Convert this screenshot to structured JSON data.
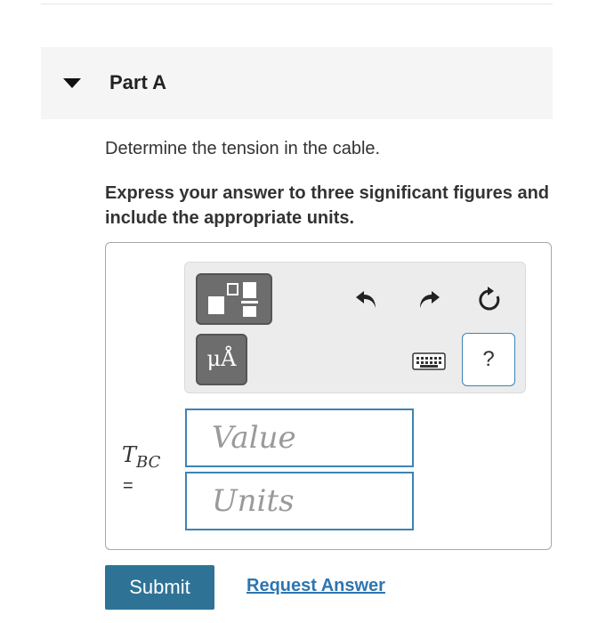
{
  "part": {
    "title": "Part A",
    "caret_icon": "caret-down-icon"
  },
  "question": {
    "prompt": "Determine the tension in the cable.",
    "instruction": "Express your answer to three significant figures and include the appropriate units."
  },
  "toolbar": {
    "templates_icon": "templates-icon",
    "units_label": "μÅ",
    "undo_icon": "undo-icon",
    "redo_icon": "redo-icon",
    "reset_icon": "reset-icon",
    "keyboard_icon": "keyboard-icon",
    "help_label": "?"
  },
  "answer": {
    "variable": "T",
    "subscript": "BC",
    "equals": "=",
    "value_placeholder": "Value",
    "units_placeholder": "Units"
  },
  "actions": {
    "submit_label": "Submit",
    "request_label": "Request Answer"
  },
  "colors": {
    "accent": "#3c83b4",
    "submit_bg": "#2e7396",
    "link": "#2e75b0",
    "tool_button": "#6d6d6d"
  }
}
